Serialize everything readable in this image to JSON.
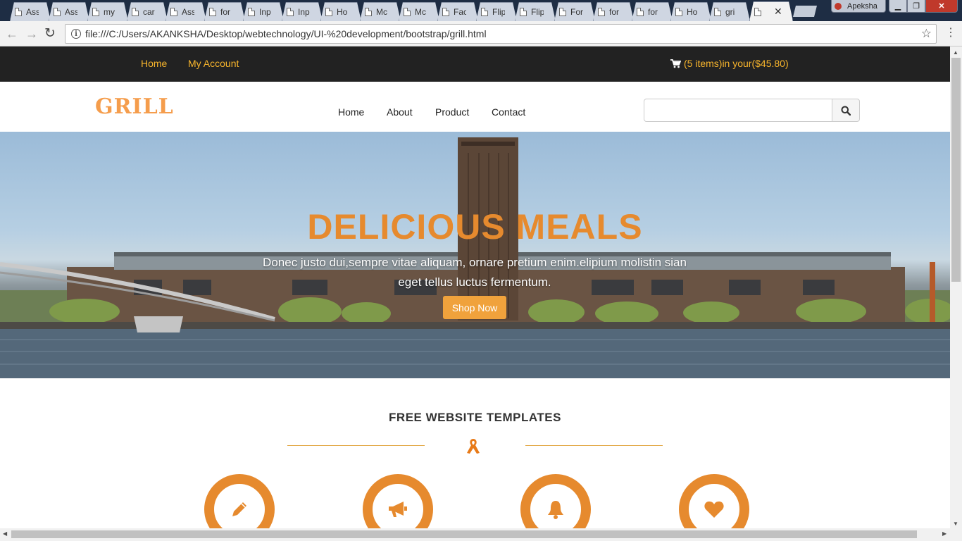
{
  "browser": {
    "tabs": [
      {
        "title": "Ass"
      },
      {
        "title": "Ass"
      },
      {
        "title": "my"
      },
      {
        "title": "car"
      },
      {
        "title": "Ass"
      },
      {
        "title": "for"
      },
      {
        "title": "Inp"
      },
      {
        "title": "Inp"
      },
      {
        "title": "Ho"
      },
      {
        "title": "Mc"
      },
      {
        "title": "Mc"
      },
      {
        "title": "Fac"
      },
      {
        "title": "Flip"
      },
      {
        "title": "Flip"
      },
      {
        "title": "For"
      },
      {
        "title": "for"
      },
      {
        "title": "for"
      },
      {
        "title": "Ho"
      },
      {
        "title": "gri"
      },
      {
        "title": ""
      }
    ],
    "user_name": "Apeksha",
    "url": "file:///C:/Users/AKANKSHA/Desktop/webtechnology/UI-%20development/bootstrap/grill.html"
  },
  "topbar": {
    "home_label": "Home",
    "account_label": "My Account",
    "cart_text": "(5 items)in your($45.80)",
    "accent": "#f8b52c"
  },
  "header": {
    "logo": "GRILL",
    "nav": [
      "Home",
      "About",
      "Product",
      "Contact"
    ],
    "search_placeholder": ""
  },
  "hero": {
    "title": "DELICIOUS MEALS",
    "subtitle_line1": "Donec justo dui,sempre vitae aliquam, ornare pretium enim.elipium molistin sian",
    "subtitle_line2": "eget tellus luctus fermentum.",
    "button_label": "Shop Now"
  },
  "section": {
    "title": "FREE WEBSITE TEMPLATES",
    "features": [
      {
        "icon": "pencil-icon"
      },
      {
        "icon": "bullhorn-icon"
      },
      {
        "icon": "bell-icon"
      },
      {
        "icon": "heart-icon"
      }
    ],
    "accent": "#e68a2e"
  }
}
